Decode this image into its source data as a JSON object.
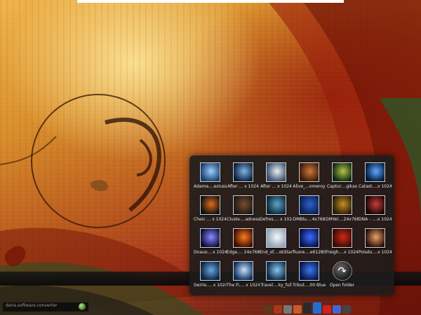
{
  "desktop": {
    "taskbar_text": "dana.software.converter"
  },
  "stack": {
    "items": [
      {
        "label": "Adama....exiuss",
        "colors": [
          "#1b3d6e",
          "#9cd0ff"
        ]
      },
      {
        "label": "After ... x 1024",
        "colors": [
          "#0c1f3b",
          "#7fb6e6"
        ]
      },
      {
        "label": "After ... x 1024",
        "colors": [
          "#3a4f6a",
          "#e8eef4"
        ]
      },
      {
        "label": "Alive_...omeroy",
        "colors": [
          "#3b1a0a",
          "#d07a3a"
        ]
      },
      {
        "label": "Captur....gikas",
        "colors": [
          "#0e2a10",
          "#b7c24a"
        ]
      },
      {
        "label": "Catast....x 1024",
        "colors": [
          "#001a3a",
          "#62a8ff"
        ]
      },
      {
        "label": "Cheic ... x 1024",
        "colors": [
          "#0d1010",
          "#e36b1e"
        ]
      },
      {
        "label": "Cluste....adness",
        "colors": [
          "#1a1a1a",
          "#7d4b2a"
        ]
      },
      {
        "label": "Defres.... x 1024",
        "colors": [
          "#0a2738",
          "#5fa6c9"
        ]
      },
      {
        "label": "DMBlu....4x768",
        "colors": [
          "#0a1f55",
          "#2e63c9"
        ]
      },
      {
        "label": "DMYel....24x768",
        "colors": [
          "#2a1d06",
          "#c68e27"
        ]
      },
      {
        "label": "DNA - ....x 1024",
        "colors": [
          "#1a0505",
          "#c73a3a"
        ]
      },
      {
        "label": "Dnauo....x 1024",
        "colors": [
          "#0c0c3a",
          "#8a8aff"
        ]
      },
      {
        "label": "Edge.... 24x768",
        "colors": [
          "#3a0d00",
          "#ff7a22"
        ]
      },
      {
        "label": "End_of....okStar",
        "colors": [
          "#8fa3b8",
          "#f5f8fb"
        ]
      },
      {
        "label": "fluore....e61280",
        "colors": [
          "#07124a",
          "#3b6bff"
        ]
      },
      {
        "label": "Freigh....x 1024",
        "colors": [
          "#3a0a05",
          "#d02a15"
        ]
      },
      {
        "label": "Poisdu....x 1024",
        "colors": [
          "#2a0d05",
          "#e8a26a"
        ]
      },
      {
        "label": "Swirle.... x 1024",
        "colors": [
          "#0b2140",
          "#6aa9e0"
        ]
      },
      {
        "label": "The Fi.... x 1024",
        "colors": [
          "#0d2d5a",
          "#c8e4ff"
        ]
      },
      {
        "label": "Travel....ky_full",
        "colors": [
          "#0a2844",
          "#8bc6f0"
        ]
      },
      {
        "label": "Tribut....00 Blue",
        "colors": [
          "#05154a",
          "#3f79f0"
        ]
      }
    ],
    "open_folder_label": "Open folder"
  },
  "colors": {
    "panel_bg": "#1c1c1c",
    "label_text": "#e6e6e6"
  }
}
